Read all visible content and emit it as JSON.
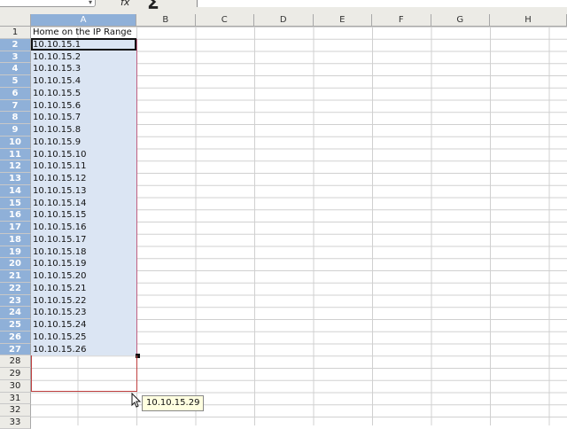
{
  "toolbar": {
    "fx_symbol": "fx",
    "sum_symbol": "Σ"
  },
  "columns": [
    "A",
    "B",
    "C",
    "D",
    "E",
    "F",
    "G",
    "H"
  ],
  "selected_column": "A",
  "header_cell": "Home on the IP Range",
  "rows": [
    "1",
    "2",
    "3",
    "4",
    "5",
    "6",
    "7",
    "8",
    "9",
    "10",
    "11",
    "12",
    "13",
    "14",
    "15",
    "16",
    "17",
    "18",
    "19",
    "20",
    "21",
    "22",
    "23",
    "24",
    "25",
    "26",
    "27",
    "28",
    "29",
    "30",
    "31",
    "32",
    "33"
  ],
  "cells": [
    "10.10.15.1",
    "10.10.15.2",
    "10.10.15.3",
    "10.10.15.4",
    "10.10.15.5",
    "10.10.15.6",
    "10.10.15.7",
    "10.10.15.8",
    "10.10.15.9",
    "10.10.15.10",
    "10.10.15.11",
    "10.10.15.12",
    "10.10.15.13",
    "10.10.15.14",
    "10.10.15.15",
    "10.10.15.16",
    "10.10.15.17",
    "10.10.15.18",
    "10.10.15.19",
    "10.10.15.20",
    "10.10.15.21",
    "10.10.15.22",
    "10.10.15.23",
    "10.10.15.24",
    "10.10.15.25",
    "10.10.15.26"
  ],
  "tooltip": "10.10.15.29",
  "colors": {
    "selection": "#dbe5f3",
    "header_selected": "#8fb0d8",
    "autofill_border": "#c04040"
  }
}
